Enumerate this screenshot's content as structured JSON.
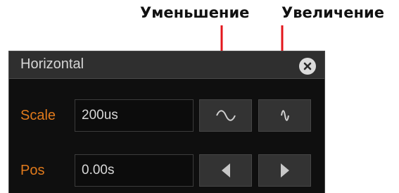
{
  "callouts": {
    "decrease": "Уменьшение",
    "increase": "Увеличение"
  },
  "dialog": {
    "title": "Horizontal",
    "close_icon": "close-icon",
    "scale": {
      "label": "Scale",
      "value": "200us",
      "decrease_icon": "sine-wave-wide-icon",
      "increase_icon": "sine-wave-narrow-icon"
    },
    "pos": {
      "label": "Pos",
      "value": "0.00s",
      "left_icon": "triangle-left-icon",
      "right_icon": "triangle-right-icon"
    }
  },
  "colors": {
    "label_accent": "#e07a1c",
    "arrow": "#e3161b",
    "panel_bg": "#0f0f0f",
    "header_bg": "#2f2f2f",
    "button_bg": "#333333"
  }
}
